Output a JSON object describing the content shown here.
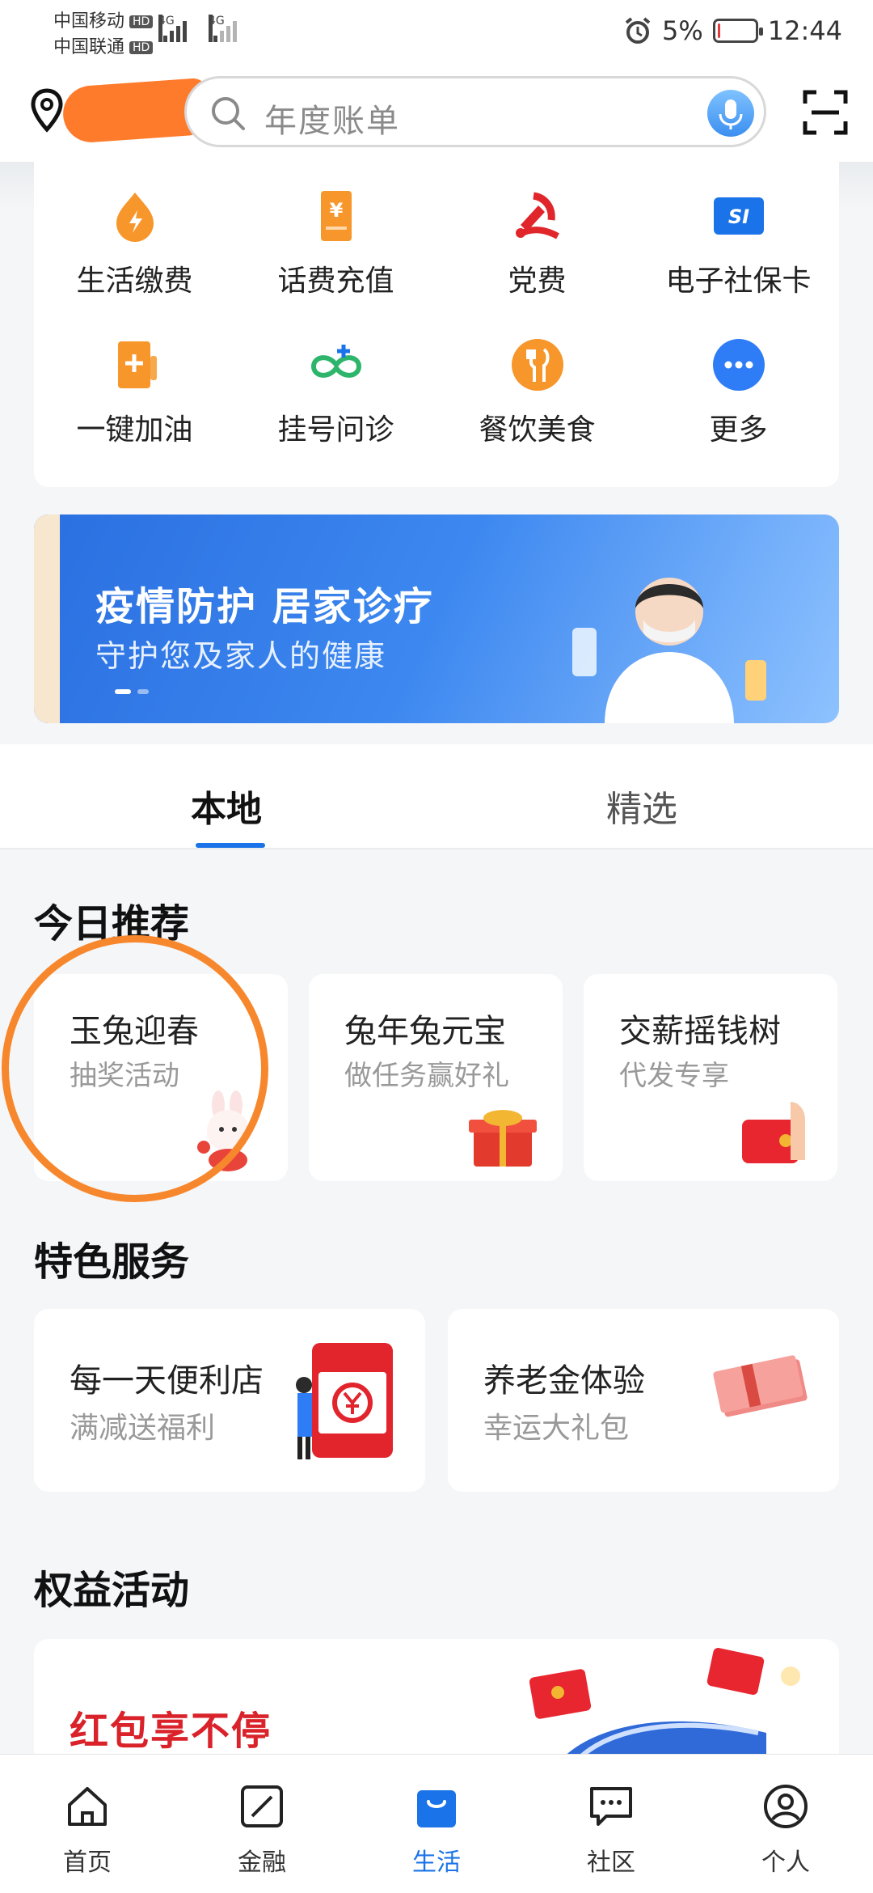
{
  "status_bar": {
    "carrier1": "中国移动",
    "carrier2": "中国联通",
    "hd": "HD",
    "network": "4G",
    "battery": "5%",
    "battery_level": 0.05,
    "time": "12:44"
  },
  "header": {
    "search_placeholder": "年度账单",
    "icons": [
      "location-pin-icon",
      "search-icon",
      "microphone-icon",
      "scan-icon"
    ]
  },
  "services": [
    {
      "label": "生活缴费",
      "icon": "utility-bill-icon",
      "color": "#f7962a"
    },
    {
      "label": "话费充值",
      "icon": "phone-recharge-icon",
      "color": "#f7962a"
    },
    {
      "label": "党费",
      "icon": "party-fee-icon",
      "color": "#e0262b"
    },
    {
      "label": "电子社保卡",
      "icon": "social-security-card-icon",
      "color": "#1a73e8"
    },
    {
      "label": "一键加油",
      "icon": "fuel-icon",
      "color": "#f7962a"
    },
    {
      "label": "挂号问诊",
      "icon": "medical-icon",
      "color": "#2db56c"
    },
    {
      "label": "餐饮美食",
      "icon": "dining-icon",
      "color": "#f7962a"
    },
    {
      "label": "更多",
      "icon": "more-icon",
      "color": "#2f7df6"
    }
  ],
  "banner": {
    "title": "疫情防护 居家诊疗",
    "subtitle": "守护您及家人的健康"
  },
  "tabs": [
    {
      "label": "本地",
      "active": true
    },
    {
      "label": "精选",
      "active": false
    }
  ],
  "today": {
    "title": "今日推荐",
    "cards": [
      {
        "title": "玉兔迎春",
        "subtitle": "抽奖活动"
      },
      {
        "title": "兔年兔元宝",
        "subtitle": "做任务赢好礼"
      },
      {
        "title": "交薪摇钱树",
        "subtitle": "代发专享"
      }
    ]
  },
  "featured": {
    "title": "特色服务",
    "cards": [
      {
        "title": "每一天便利店",
        "subtitle": "满减送福利"
      },
      {
        "title": "养老金体验",
        "subtitle": "幸运大礼包"
      }
    ]
  },
  "rights": {
    "title": "权益活动",
    "card_title": "红包享不停"
  },
  "nav": [
    {
      "label": "首页",
      "icon": "home-icon",
      "active": false
    },
    {
      "label": "金融",
      "icon": "finance-icon",
      "active": false
    },
    {
      "label": "生活",
      "icon": "life-bag-icon",
      "active": true
    },
    {
      "label": "社区",
      "icon": "community-chat-icon",
      "active": false
    },
    {
      "label": "个人",
      "icon": "profile-icon",
      "active": false
    }
  ],
  "colors": {
    "accent": "#1a73e8",
    "annotation_circle": "#f7872c",
    "red_text": "#d9222a"
  }
}
